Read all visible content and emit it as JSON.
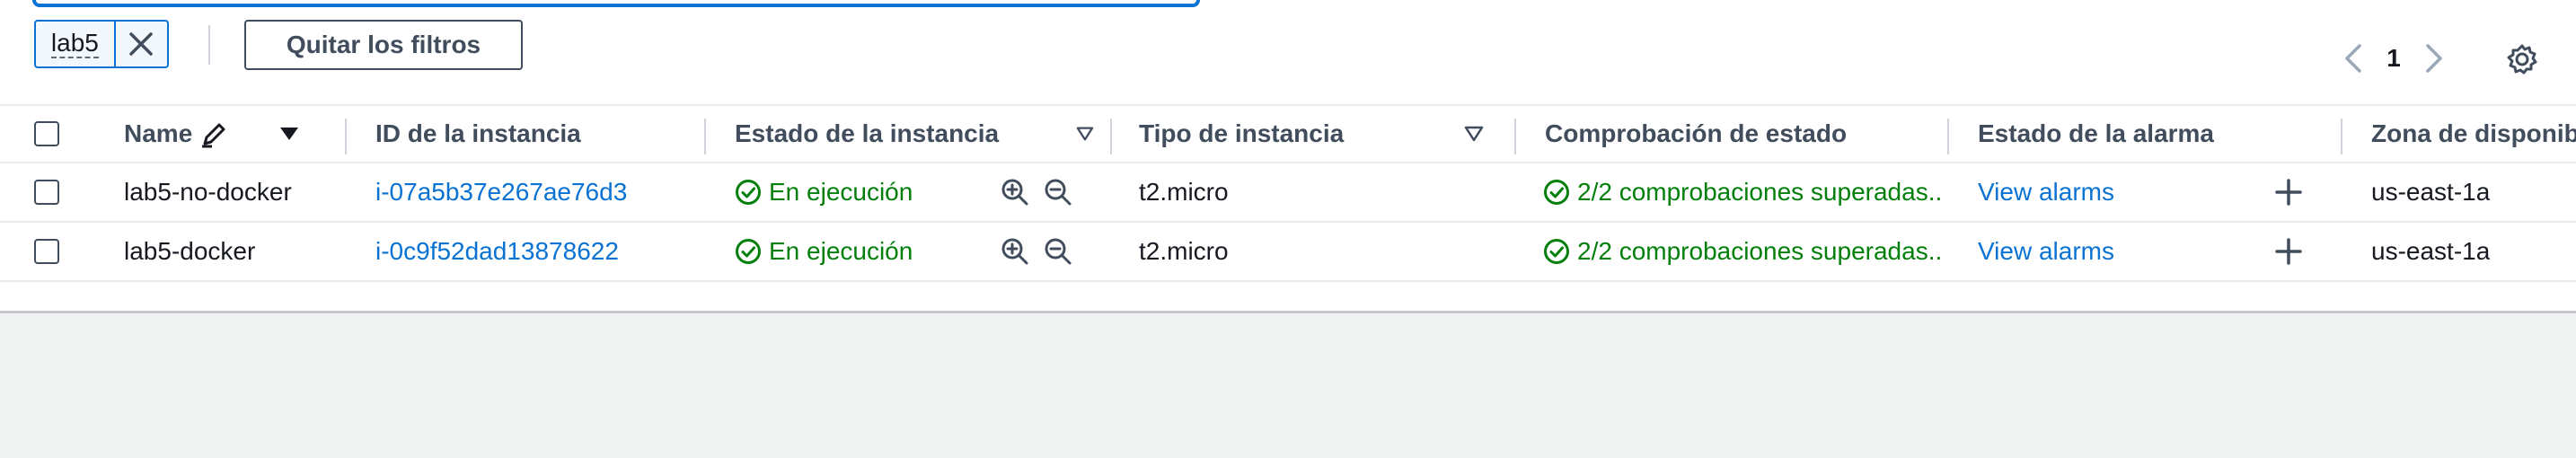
{
  "filter": {
    "token_label": "lab5",
    "clear_button": "Quitar los filtros"
  },
  "pagination": {
    "current_page": "1"
  },
  "table": {
    "columns": [
      "Name",
      "ID de la instancia",
      "Estado de la instancia",
      "Tipo de instancia",
      "Comprobación de estado",
      "Estado de la alarma",
      "Zona de disponib"
    ],
    "rows": [
      {
        "name": "lab5-no-docker",
        "instance_id": "i-07a5b37e267ae76d3",
        "state": "En ejecución",
        "type": "t2.micro",
        "status_check": "2/2 comprobaciones superadas..",
        "alarm": "View alarms",
        "zone": "us-east-1a"
      },
      {
        "name": "lab5-docker",
        "instance_id": "i-0c9f52dad13878622",
        "state": "En ejecución",
        "type": "t2.micro",
        "status_check": "2/2 comprobaciones superadas..",
        "alarm": "View alarms",
        "zone": "us-east-1a"
      }
    ]
  },
  "colors": {
    "link": "#0972d3",
    "success": "#037f0c",
    "header_text": "#414d5c",
    "grey_background": "#f2f3f3"
  },
  "icons": [
    "close-icon",
    "chevron-left-icon",
    "chevron-right-icon",
    "gear-icon",
    "edit-pencil-icon",
    "sort-desc-icon",
    "filter-funnel-icon",
    "check-circle-icon",
    "zoom-in-icon",
    "zoom-out-icon",
    "plus-icon"
  ]
}
